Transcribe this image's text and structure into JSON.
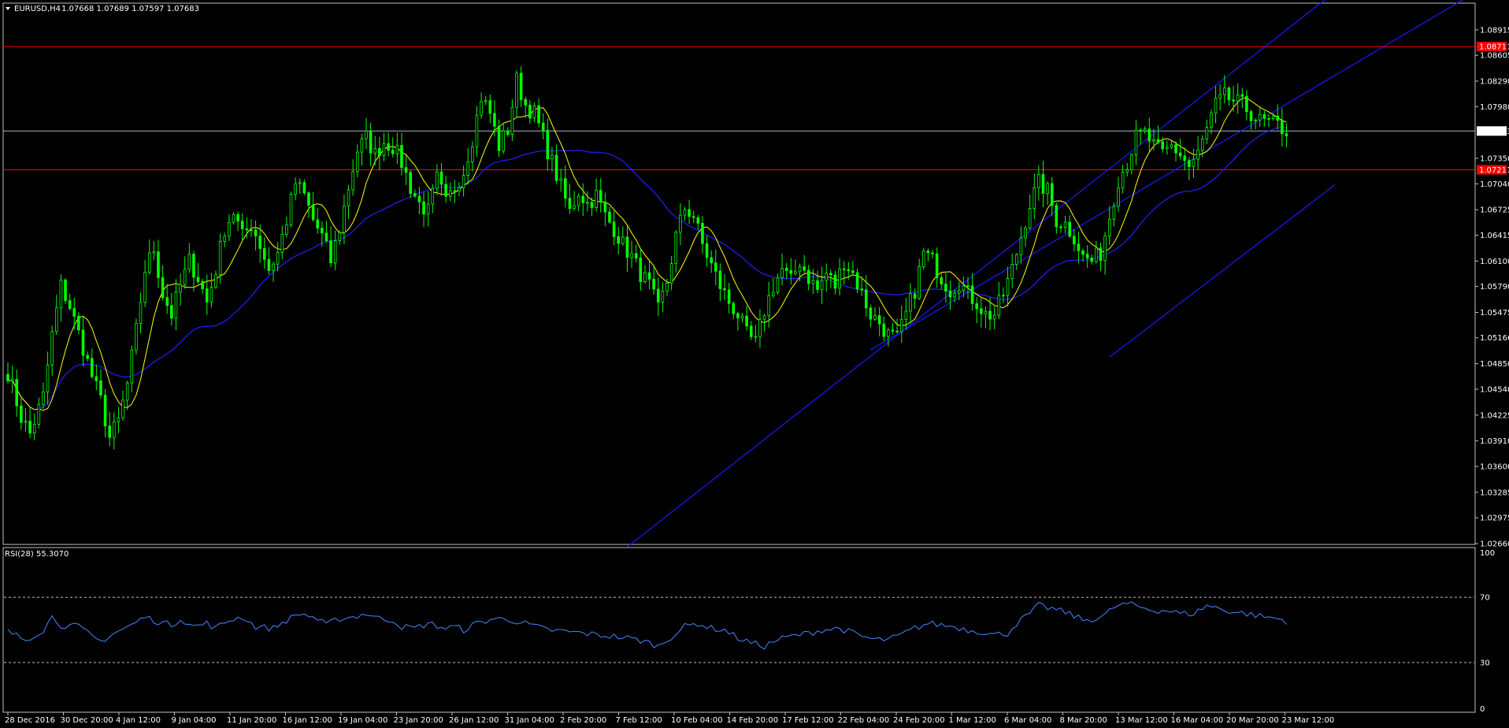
{
  "header": {
    "symbol": "EURUSD,H4",
    "ohlc": "1.07668 1.07689 1.07597 1.07683"
  },
  "rsi_panel": {
    "label": "RSI(28) 55.3070",
    "levels": [
      "100",
      "70",
      "30",
      "0"
    ]
  },
  "colors": {
    "background": "#000000",
    "frame": "#c0c0c0",
    "candle": "#00ff00",
    "ma_fast": "#ffff00",
    "ma_slow": "#2020ff",
    "channel": "#1a1aff",
    "hline": "#ff0000",
    "current_price_line": "#aab4c8",
    "rsi_line": "#4488ff",
    "rsi_level": "#c0c0c0"
  },
  "chart_data": {
    "type": "line",
    "x_tick_labels": [
      "28 Dec 2016",
      "30 Dec 20:00",
      "4 Jan 12:00",
      "9 Jan 04:00",
      "11 Jan 20:00",
      "16 Jan 12:00",
      "19 Jan 04:00",
      "23 Jan 20:00",
      "26 Jan 12:00",
      "31 Jan 04:00",
      "2 Feb 20:00",
      "7 Feb 12:00",
      "10 Feb 04:00",
      "14 Feb 20:00",
      "17 Feb 12:00",
      "22 Feb 04:00",
      "24 Feb 20:00",
      "1 Mar 12:00",
      "6 Mar 04:00",
      "8 Mar 20:00",
      "13 Mar 12:00",
      "16 Mar 04:00",
      "20 Mar 20:00",
      "23 Mar 12:00"
    ],
    "y_tick_labels": [
      "1.08915",
      "1.08605",
      "1.08290",
      "1.07980",
      "1.07350",
      "1.07040",
      "1.06725",
      "1.06415",
      "1.06100",
      "1.05790",
      "1.05475",
      "1.05166",
      "1.04850",
      "1.04540",
      "1.04225",
      "1.03910",
      "1.03600",
      "1.03285",
      "1.02975",
      "1.02660"
    ],
    "ylim": [
      1.0266,
      1.0923
    ],
    "current_price": {
      "value": 1.07683,
      "label": "1.07683"
    },
    "hlines": [
      {
        "value": 1.08711,
        "label": "1.08711"
      },
      {
        "value": 1.07211,
        "label": "1.07211"
      }
    ],
    "price_anchors": [
      [
        0,
        1.0475
      ],
      [
        3,
        1.042
      ],
      [
        5,
        1.04
      ],
      [
        8,
        1.0445
      ],
      [
        10,
        1.052
      ],
      [
        12,
        1.058
      ],
      [
        14,
        1.0555
      ],
      [
        17,
        1.0505
      ],
      [
        19,
        1.047
      ],
      [
        21,
        1.044
      ],
      [
        23,
        1.0395
      ],
      [
        25,
        1.0415
      ],
      [
        27,
        1.046
      ],
      [
        29,
        1.0525
      ],
      [
        31,
        1.06
      ],
      [
        33,
        1.0625
      ],
      [
        35,
        1.057
      ],
      [
        37,
        1.0545
      ],
      [
        39,
        1.058
      ],
      [
        41,
        1.061
      ],
      [
        43,
        1.059
      ],
      [
        45,
        1.056
      ],
      [
        47,
        1.06
      ],
      [
        49,
        1.065
      ],
      [
        51,
        1.067
      ],
      [
        53,
        1.064
      ],
      [
        55,
        1.0655
      ],
      [
        57,
        1.063
      ],
      [
        59,
        1.06
      ],
      [
        61,
        1.062
      ],
      [
        63,
        1.066
      ],
      [
        65,
        1.0705
      ],
      [
        67,
        1.069
      ],
      [
        69,
        1.066
      ],
      [
        71,
        1.064
      ],
      [
        73,
        1.061
      ],
      [
        75,
        1.065
      ],
      [
        77,
        1.07
      ],
      [
        79,
        1.0745
      ],
      [
        81,
        1.076
      ],
      [
        83,
        1.074
      ],
      [
        85,
        1.0755
      ],
      [
        87,
        1.075
      ],
      [
        89,
        1.073
      ],
      [
        91,
        1.07
      ],
      [
        93,
        1.068
      ],
      [
        95,
        1.067
      ],
      [
        97,
        1.071
      ],
      [
        99,
        1.068
      ],
      [
        101,
        1.07
      ],
      [
        103,
        1.072
      ],
      [
        105,
        1.076
      ],
      [
        107,
        1.081
      ],
      [
        109,
        1.079
      ],
      [
        111,
        1.075
      ],
      [
        113,
        1.077
      ],
      [
        115,
        1.083
      ],
      [
        117,
        1.08
      ],
      [
        119,
        1.079
      ],
      [
        121,
        1.076
      ],
      [
        123,
        1.073
      ],
      [
        125,
        1.07
      ],
      [
        127,
        1.067
      ],
      [
        129,
        1.0695
      ],
      [
        131,
        1.068
      ],
      [
        133,
        1.069
      ],
      [
        135,
        1.0665
      ],
      [
        137,
        1.065
      ],
      [
        139,
        1.063
      ],
      [
        141,
        1.0615
      ],
      [
        143,
        1.0595
      ],
      [
        145,
        1.058
      ],
      [
        147,
        1.055
      ],
      [
        149,
        1.0585
      ],
      [
        151,
        1.064
      ],
      [
        153,
        1.0675
      ],
      [
        155,
        1.0665
      ],
      [
        157,
        1.063
      ],
      [
        159,
        1.0605
      ],
      [
        161,
        1.058
      ],
      [
        163,
        1.056
      ],
      [
        165,
        1.0545
      ],
      [
        167,
        1.052
      ],
      [
        169,
        1.051
      ],
      [
        171,
        1.055
      ],
      [
        173,
        1.058
      ],
      [
        175,
        1.06
      ],
      [
        177,
        1.0585
      ],
      [
        179,
        1.061
      ],
      [
        181,
        1.059
      ],
      [
        183,
        1.0575
      ],
      [
        185,
        1.0595
      ],
      [
        187,
        1.058
      ],
      [
        189,
        1.061
      ],
      [
        191,
        1.0595
      ],
      [
        193,
        1.057
      ],
      [
        195,
        1.0545
      ],
      [
        197,
        1.0535
      ],
      [
        199,
        1.052
      ],
      [
        201,
        1.0515
      ],
      [
        203,
        1.0545
      ],
      [
        205,
        1.0575
      ],
      [
        207,
        1.062
      ],
      [
        209,
        1.061
      ],
      [
        211,
        1.059
      ],
      [
        213,
        1.0575
      ],
      [
        215,
        1.0585
      ],
      [
        217,
        1.057
      ],
      [
        219,
        1.056
      ],
      [
        221,
        1.0545
      ],
      [
        223,
        1.0545
      ],
      [
        225,
        1.057
      ],
      [
        227,
        1.06
      ],
      [
        229,
        1.064
      ],
      [
        231,
        1.068
      ],
      [
        233,
        1.0705
      ],
      [
        235,
        1.0695
      ],
      [
        237,
        1.066
      ],
      [
        239,
        1.0655
      ],
      [
        241,
        1.064
      ],
      [
        243,
        1.0615
      ],
      [
        245,
        1.061
      ],
      [
        247,
        1.062
      ],
      [
        249,
        1.0665
      ],
      [
        251,
        1.071
      ],
      [
        253,
        1.073
      ],
      [
        255,
        1.076
      ],
      [
        257,
        1.0765
      ],
      [
        259,
        1.075
      ],
      [
        261,
        1.074
      ],
      [
        263,
        1.075
      ],
      [
        265,
        1.074
      ],
      [
        267,
        1.0725
      ],
      [
        269,
        1.074
      ],
      [
        271,
        1.077
      ],
      [
        273,
        1.08
      ],
      [
        275,
        1.081
      ],
      [
        277,
        1.0805
      ],
      [
        279,
        1.08
      ],
      [
        281,
        1.079
      ],
      [
        283,
        1.078
      ],
      [
        285,
        1.0778
      ],
      [
        287,
        1.0775
      ],
      [
        289,
        1.0768
      ]
    ],
    "channel_lines": [
      {
        "from": [
          140,
          1.0262
        ],
        "to": [
          300,
          1.0938
        ]
      },
      {
        "from": [
          195,
          1.0502
        ],
        "to": [
          332,
          1.0938
        ]
      },
      {
        "from": [
          249,
          1.0493
        ],
        "to": [
          300,
          1.0703
        ]
      }
    ],
    "rsi": {
      "ylim": [
        0,
        100
      ],
      "levels": [
        70,
        30
      ],
      "anchors": [
        [
          0,
          49
        ],
        [
          4,
          44
        ],
        [
          8,
          50
        ],
        [
          10,
          58
        ],
        [
          12,
          53
        ],
        [
          16,
          52
        ],
        [
          19,
          46
        ],
        [
          21,
          43
        ],
        [
          24,
          48
        ],
        [
          28,
          53
        ],
        [
          31,
          58
        ],
        [
          34,
          55
        ],
        [
          37,
          53
        ],
        [
          39,
          57
        ],
        [
          42,
          52
        ],
        [
          45,
          54
        ],
        [
          47,
          51
        ],
        [
          50,
          56
        ],
        [
          53,
          58
        ],
        [
          56,
          52
        ],
        [
          60,
          51
        ],
        [
          63,
          56
        ],
        [
          66,
          60
        ],
        [
          69,
          58
        ],
        [
          72,
          53
        ],
        [
          75,
          57
        ],
        [
          78,
          58
        ],
        [
          81,
          60
        ],
        [
          84,
          57
        ],
        [
          87,
          56
        ],
        [
          89,
          52
        ],
        [
          92,
          51
        ],
        [
          95,
          54
        ],
        [
          99,
          51
        ],
        [
          101,
          52
        ],
        [
          103,
          50
        ],
        [
          106,
          54
        ],
        [
          110,
          57
        ],
        [
          114,
          56
        ],
        [
          118,
          53
        ],
        [
          122,
          50
        ],
        [
          126,
          49
        ],
        [
          130,
          48
        ],
        [
          133,
          47
        ],
        [
          137,
          46
        ],
        [
          140,
          45
        ],
        [
          144,
          43
        ],
        [
          147,
          40
        ],
        [
          150,
          46
        ],
        [
          153,
          52
        ],
        [
          156,
          54
        ],
        [
          159,
          51
        ],
        [
          162,
          50
        ],
        [
          165,
          45
        ],
        [
          168,
          42
        ],
        [
          171,
          40
        ],
        [
          174,
          44
        ],
        [
          177,
          46
        ],
        [
          181,
          48
        ],
        [
          184,
          50
        ],
        [
          188,
          51
        ],
        [
          190,
          49
        ],
        [
          193,
          46
        ],
        [
          196,
          44
        ],
        [
          199,
          44
        ],
        [
          202,
          47
        ],
        [
          205,
          51
        ],
        [
          208,
          54
        ],
        [
          211,
          53
        ],
        [
          214,
          52
        ],
        [
          217,
          50
        ],
        [
          220,
          49
        ],
        [
          223,
          47
        ],
        [
          226,
          48
        ],
        [
          228,
          54
        ],
        [
          231,
          60
        ],
        [
          233,
          65
        ],
        [
          236,
          63
        ],
        [
          240,
          60
        ],
        [
          243,
          56
        ],
        [
          246,
          57
        ],
        [
          248,
          59
        ],
        [
          250,
          64
        ],
        [
          253,
          66
        ],
        [
          256,
          64
        ],
        [
          259,
          62
        ],
        [
          262,
          62
        ],
        [
          265,
          60
        ],
        [
          268,
          60
        ],
        [
          271,
          65
        ],
        [
          274,
          63
        ],
        [
          277,
          61
        ],
        [
          280,
          60
        ],
        [
          284,
          58
        ],
        [
          287,
          57
        ],
        [
          289,
          55.3
        ]
      ]
    },
    "grid": false,
    "legend": "none"
  }
}
